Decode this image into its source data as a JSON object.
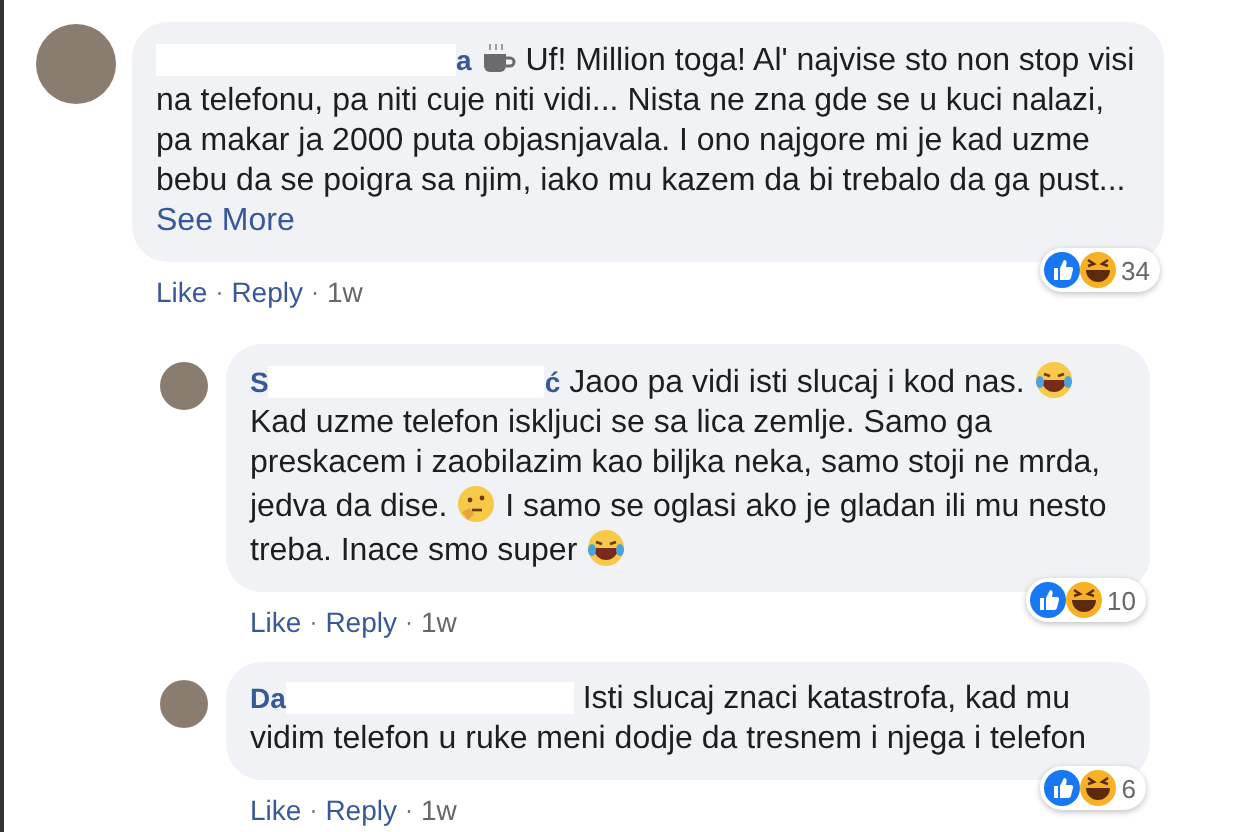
{
  "comments": [
    {
      "author_end": "a",
      "body": [
        {
          "kind": "coffee"
        },
        {
          "kind": "text",
          "text": " Uf! Million toga! Al' najvise sto non stop visi na telefonu, pa niti cuje niti vidi... Nista ne zna gde se u kuci nalazi, pa makar ja 2000 puta objasnjavala. I ono najgore mi je kad uzme bebu da se poigra sa njim, iako mu kazem da bi trebalo da ga pust..."
        }
      ],
      "see_more": "See More",
      "reaction_count": "34",
      "footer": [
        {
          "kind": "link",
          "text": "Like"
        },
        {
          "kind": "dot",
          "text": "·"
        },
        {
          "kind": "link",
          "text": "Reply"
        },
        {
          "kind": "dot",
          "text": "·"
        },
        {
          "kind": "time",
          "text": "1w"
        }
      ],
      "replies": [
        {
          "author_start": "S",
          "author_end": "ć",
          "body": [
            {
              "kind": "text",
              "text": "Jaoo pa vidi isti slucaj i kod nas. "
            },
            {
              "kind": "laugh"
            },
            {
              "kind": "text",
              "text": " Kad uzme telefon iskljuci se sa lica zemlje. Samo ga preskacem i zaobilazim kao biljka neka, samo stoji ne mrda, jedva da dise. "
            },
            {
              "kind": "think"
            },
            {
              "kind": "text",
              "text": " I samo se oglasi ako je gladan ili mu nesto treba. Inace smo super "
            },
            {
              "kind": "laugh"
            }
          ],
          "reaction_count": "10",
          "footer": [
            {
              "kind": "link",
              "text": "Like"
            },
            {
              "kind": "dot",
              "text": "·"
            },
            {
              "kind": "link",
              "text": "Reply"
            },
            {
              "kind": "dot",
              "text": "·"
            },
            {
              "kind": "time",
              "text": "1w"
            }
          ]
        },
        {
          "author_start": "Da",
          "body": [
            {
              "kind": "text",
              "text": "Isti slucaj znaci katastrofa, kad mu vidim telefon u ruke meni dodje da tresnem i njega i telefon"
            }
          ],
          "reaction_count": "6",
          "footer": [
            {
              "kind": "link",
              "text": "Like"
            },
            {
              "kind": "dot",
              "text": "·"
            },
            {
              "kind": "link",
              "text": "Reply"
            },
            {
              "kind": "dot",
              "text": "·"
            },
            {
              "kind": "time",
              "text": "1w"
            }
          ]
        }
      ]
    }
  ]
}
